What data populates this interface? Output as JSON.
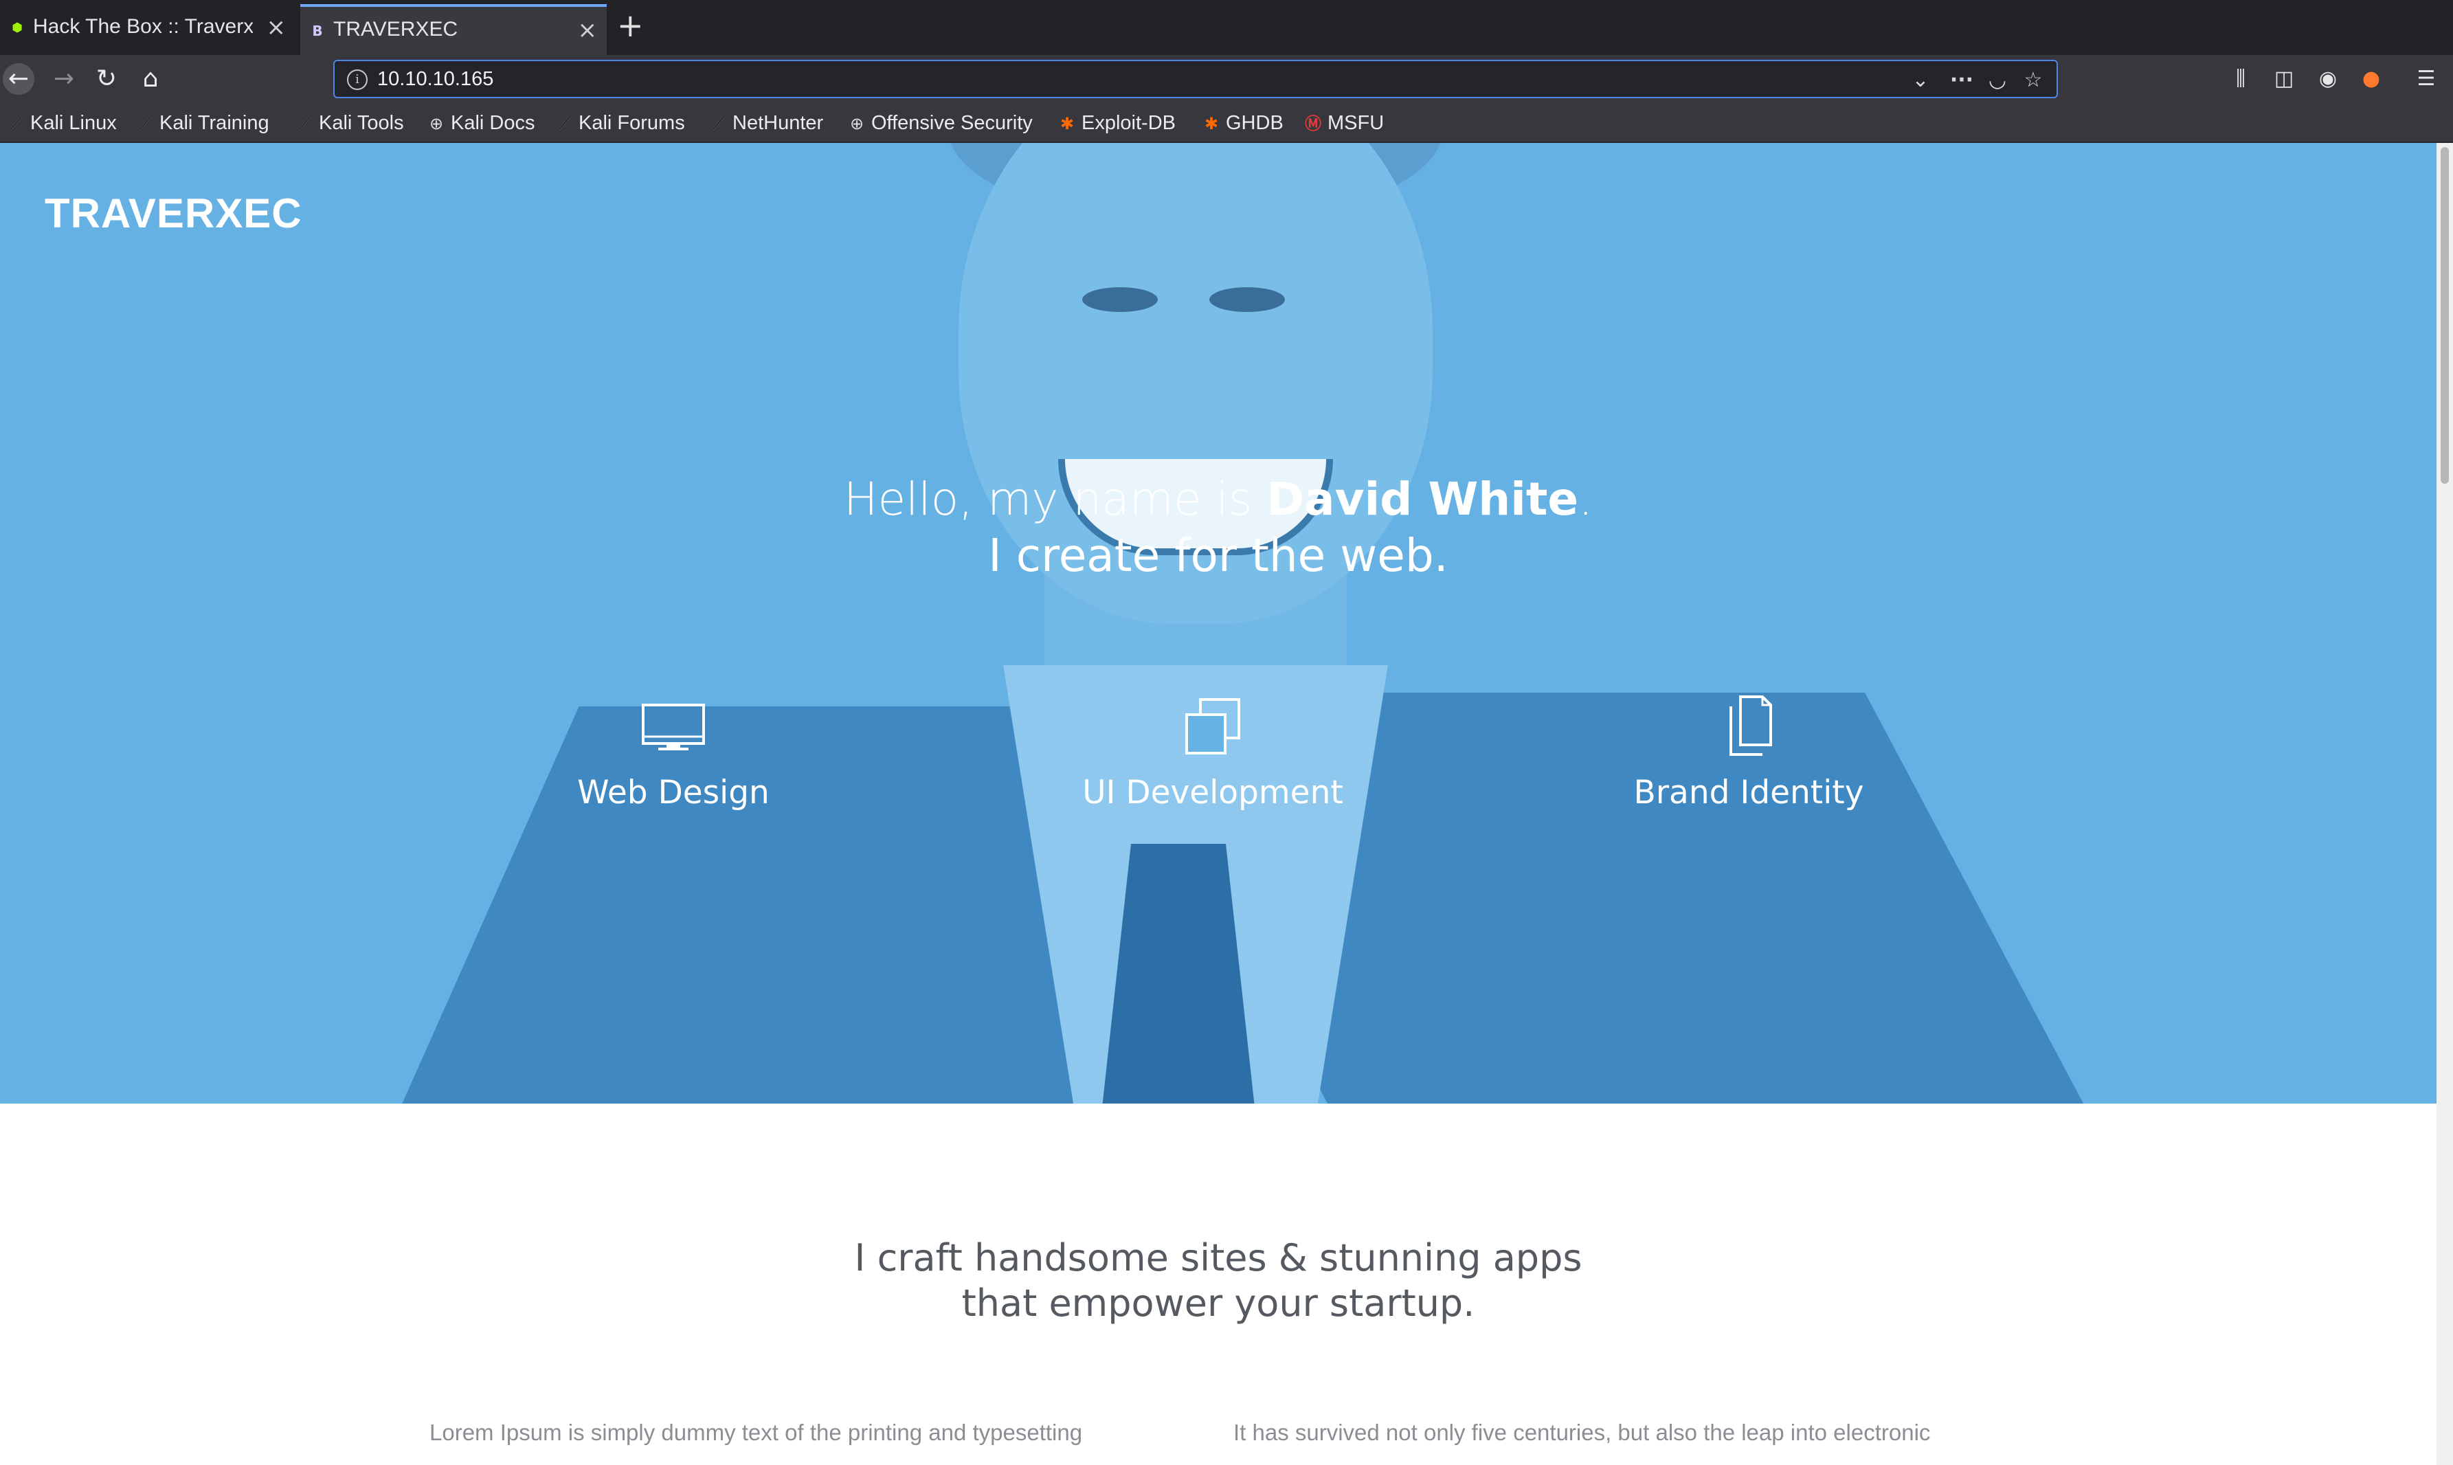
{
  "browser": {
    "tabs": [
      {
        "title": "Hack The Box :: Traverxec",
        "active": false,
        "favicon": "htb-cube-icon"
      },
      {
        "title": "TRAVERXEC",
        "active": true,
        "favicon": "bootstrap-b-icon",
        "favicon_letter": "B"
      }
    ],
    "new_tab_glyph": "+",
    "url": "10.10.10.165",
    "bookmarks": [
      {
        "label": "Kali Linux",
        "icon": "kali-dragon-icon"
      },
      {
        "label": "Kali Training",
        "icon": "kali-dragon-icon"
      },
      {
        "label": "Kali Tools",
        "icon": "kali-dragon-icon"
      },
      {
        "label": "Kali Docs",
        "icon": "globe-icon"
      },
      {
        "label": "Kali Forums",
        "icon": "kali-dragon-icon"
      },
      {
        "label": "NetHunter",
        "icon": "kali-dragon-icon"
      },
      {
        "label": "Offensive Security",
        "icon": "globe-icon"
      },
      {
        "label": "Exploit-DB",
        "icon": "exploitdb-icon"
      },
      {
        "label": "GHDB",
        "icon": "exploitdb-icon"
      },
      {
        "label": "MSFU",
        "icon": "msfu-icon"
      }
    ],
    "accent_color": "#4f86e8"
  },
  "page": {
    "brand": "TRAVERXEC",
    "hero": {
      "greeting_prefix": "Hello, my name is ",
      "name": "David White",
      "greeting_suffix": ".",
      "line2": "I create for the web.",
      "background_color": "#66b1e3"
    },
    "services": [
      {
        "label": "Web Design",
        "icon": "monitor-icon"
      },
      {
        "label": "UI Development",
        "icon": "windows-stack-icon"
      },
      {
        "label": "Brand Identity",
        "icon": "documents-icon"
      }
    ],
    "tagline_line1": "I craft handsome sites & stunning apps",
    "tagline_line2": "that empower your startup.",
    "paragraph_left": "Lorem Ipsum is simply dummy text of the printing and typesetting",
    "paragraph_right": "It has survived not only five centuries, but also the leap into electronic"
  }
}
